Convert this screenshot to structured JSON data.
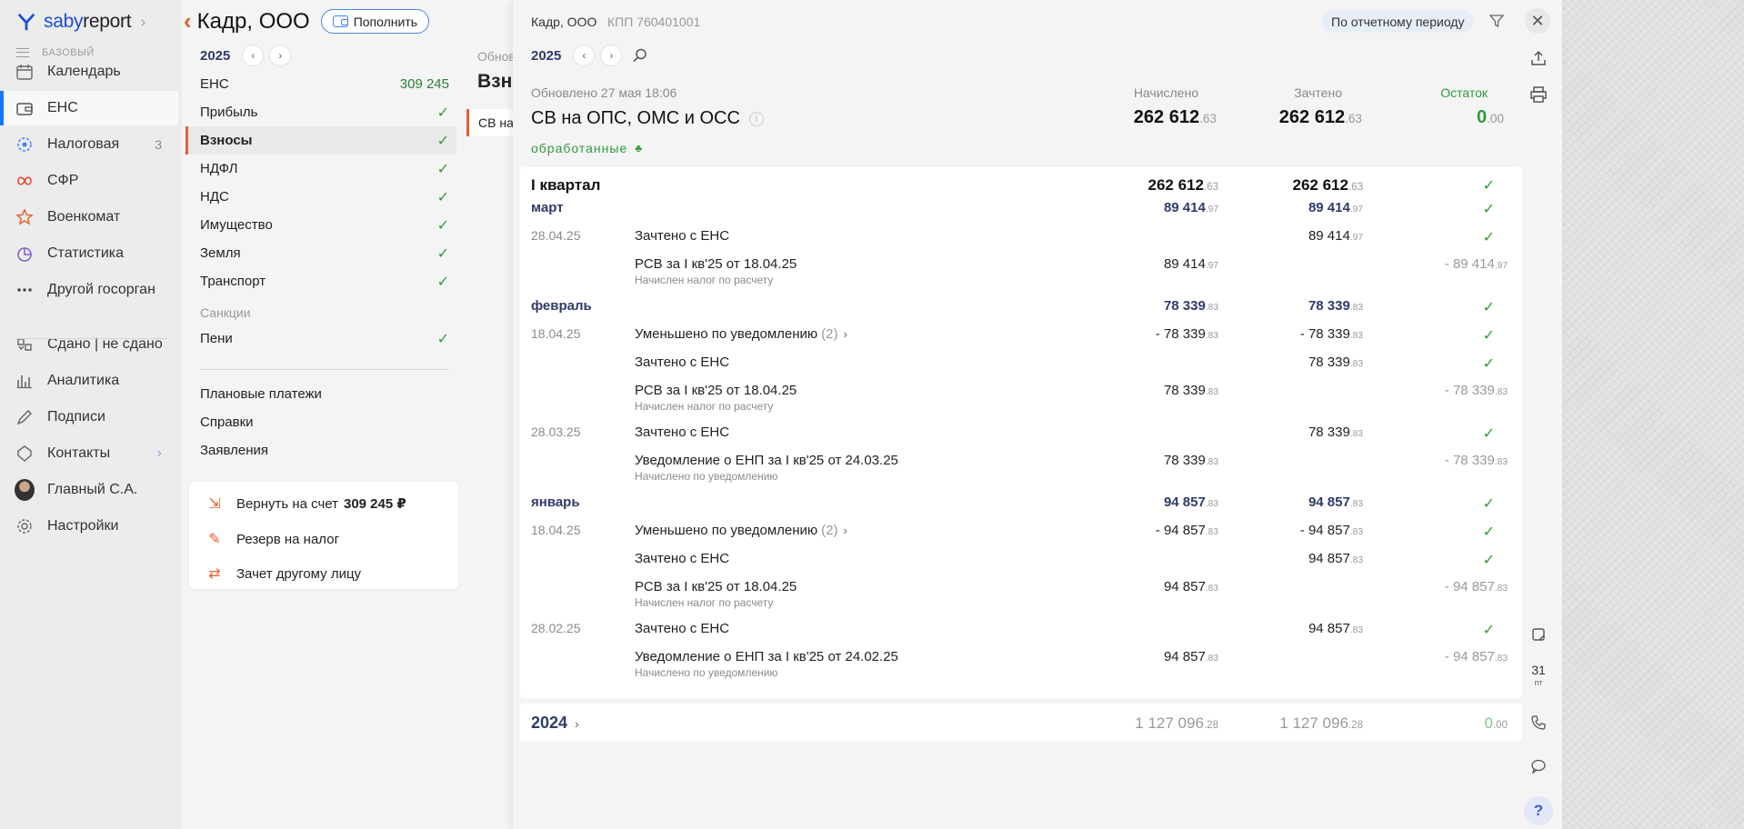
{
  "nav": {
    "brand_a": "saby",
    "brand_b": "report",
    "plan": "БАЗОВЫЙ",
    "items": [
      {
        "label": "Календарь",
        "icon": "calendar-icon"
      },
      {
        "label": "ЕНС",
        "icon": "wallet-icon",
        "active": true
      },
      {
        "label": "Налоговая",
        "icon": "tax-office-icon",
        "badge": "3"
      },
      {
        "label": "СФР",
        "icon": "sfr-icon"
      },
      {
        "label": "Военкомат",
        "icon": "star-icon"
      },
      {
        "label": "Статистика",
        "icon": "pie-chart-icon"
      },
      {
        "label": "Другой госорган",
        "icon": "more-dots-icon"
      },
      {
        "label": "Сдано | не сдано",
        "icon": "reports-status-icon"
      },
      {
        "label": "Аналитика",
        "icon": "bar-chart-icon"
      },
      {
        "label": "Подписи",
        "icon": "signature-icon"
      },
      {
        "label": "Контакты",
        "icon": "contacts-icon"
      },
      {
        "label": "Главный С.А.",
        "icon": "user-avatar"
      },
      {
        "label": "Настройки",
        "icon": "gear-icon"
      }
    ]
  },
  "mid": {
    "company": "Кадр, ООО",
    "topup": "Пополнить",
    "year": "2025",
    "taxes": [
      {
        "label": "ЕНС",
        "value": "309 245"
      },
      {
        "label": "Прибыль"
      },
      {
        "label": "Взносы",
        "selected": true
      },
      {
        "label": "НДФЛ"
      },
      {
        "label": "НДС"
      },
      {
        "label": "Имущество"
      },
      {
        "label": "Земля"
      },
      {
        "label": "Транспорт"
      }
    ],
    "sanctions_label": "Санкции",
    "sanctions": [
      {
        "label": "Пени"
      }
    ],
    "links": [
      "Плановые платежи",
      "Справки",
      "Заявления"
    ],
    "actions": {
      "refund": "Вернуть на счет",
      "refund_amount": "309 245 ₽",
      "reserve": "Резерв на налог",
      "offset": "Зачет другому лицу"
    },
    "peek": {
      "updated": "Обновлено",
      "title": "Взносы",
      "item": "СВ на"
    }
  },
  "panel": {
    "org": "Кадр, ООО",
    "kpp": "КПП 760401001",
    "period_btn": "По отчетному периоду",
    "year": "2025",
    "updated": "Обновлено 27 мая 18:06",
    "title": "СВ на ОПС, ОМС и ОСС",
    "status": "обработанные",
    "col_accrued": "Начислено",
    "col_credited": "Зачтено",
    "col_balance": "Остаток",
    "total_accrued": "262 612",
    "total_accrued_c": ".63",
    "total_credited": "262 612",
    "total_credited_c": ".63",
    "total_balance": "0",
    "total_balance_c": ".00",
    "quarter": {
      "label": "I квартал",
      "v1": "262 612",
      "v1c": ".63",
      "v2": "262 612",
      "v2c": ".63"
    },
    "rows": [
      {
        "type": "m",
        "desc": "март",
        "v1": "89 414",
        "v1c": ".97",
        "v2": "89 414",
        "v2c": ".97",
        "check": true
      },
      {
        "type": "e",
        "date": "28.04.25",
        "desc": "Зачтено с ЕНС",
        "v2": "89 414",
        "v2c": ".97",
        "check": true
      },
      {
        "type": "e",
        "desc": "РСВ за I кв'25 от 18.04.25",
        "sub": "Начислен налог по расчету",
        "v1": "89 414",
        "v1c": ".97",
        "v3": "- 89 414",
        "v3c": ".97"
      },
      {
        "type": "m",
        "desc": "февраль",
        "v1": "78 339",
        "v1c": ".83",
        "v2": "78 339",
        "v2c": ".83",
        "check": true
      },
      {
        "type": "e",
        "date": "18.04.25",
        "desc": "Уменьшено по уведомлению",
        "count": "(2)",
        "v1": "- 78 339",
        "v1c": ".83",
        "v2": "- 78 339",
        "v2c": ".83",
        "check": true
      },
      {
        "type": "e",
        "desc": "Зачтено с ЕНС",
        "v2": "78 339",
        "v2c": ".83",
        "check": true
      },
      {
        "type": "e",
        "desc": "РСВ за I кв'25 от 18.04.25",
        "sub": "Начислен налог по расчету",
        "v1": "78 339",
        "v1c": ".83",
        "v3": "- 78 339",
        "v3c": ".83"
      },
      {
        "type": "e",
        "date": "28.03.25",
        "desc": "Зачтено с ЕНС",
        "v2": "78 339",
        "v2c": ".83",
        "check": true
      },
      {
        "type": "e",
        "desc": "Уведомление о ЕНП за I кв'25 от 24.03.25",
        "sub": "Начислено по уведомлению",
        "v1": "78 339",
        "v1c": ".83",
        "v3": "- 78 339",
        "v3c": ".83"
      },
      {
        "type": "m",
        "desc": "январь",
        "v1": "94 857",
        "v1c": ".83",
        "v2": "94 857",
        "v2c": ".83",
        "check": true
      },
      {
        "type": "e",
        "date": "18.04.25",
        "desc": "Уменьшено по уведомлению",
        "count": "(2)",
        "v1": "- 94 857",
        "v1c": ".83",
        "v2": "- 94 857",
        "v2c": ".83",
        "check": true
      },
      {
        "type": "e",
        "desc": "Зачтено с ЕНС",
        "v2": "94 857",
        "v2c": ".83",
        "check": true
      },
      {
        "type": "e",
        "desc": "РСВ за I кв'25 от 18.04.25",
        "sub": "Начислен налог по расчету",
        "v1": "94 857",
        "v1c": ".83",
        "v3": "- 94 857",
        "v3c": ".83"
      },
      {
        "type": "e",
        "date": "28.02.25",
        "desc": "Зачтено с ЕНС",
        "v2": "94 857",
        "v2c": ".83",
        "check": true
      },
      {
        "type": "e",
        "desc": "Уведомление о ЕНП за I кв'25 от 24.02.25",
        "sub": "Начислено по уведомлению",
        "v1": "94 857",
        "v1c": ".83",
        "v3": "- 94 857",
        "v3c": ".83"
      }
    ],
    "prev_year": {
      "label": "2024",
      "v1": "1 127 096",
      "v1c": ".28",
      "v2": "1 127 096",
      "v2c": ".28",
      "v3": "0",
      "v3c": ".00"
    }
  },
  "toolbar": {
    "calendar_day": "31",
    "calendar_weekday": "пт",
    "help": "?"
  },
  "colors": {
    "accent": "#1976ff",
    "brand_orange": "#e5602e",
    "ok_green": "#2e9b3b",
    "month_blue": "#2f3b69"
  }
}
